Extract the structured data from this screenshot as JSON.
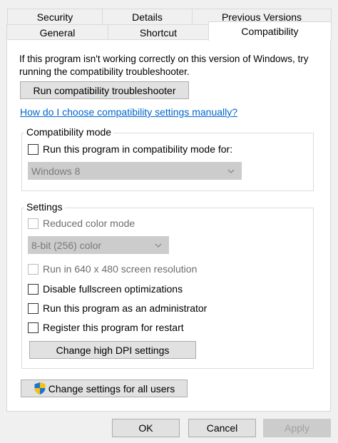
{
  "tabs_row1": [
    "Security",
    "Details",
    "Previous Versions"
  ],
  "tabs_row2": [
    "General",
    "Shortcut",
    "Compatibility"
  ],
  "intro": {
    "line1": "If this program isn't working correctly on this version of Windows, try",
    "line2": "running the compatibility troubleshooter."
  },
  "run_troubleshooter": "Run compatibility troubleshooter",
  "help_link": "How do I choose compatibility settings manually?",
  "compat_mode": {
    "legend": "Compatibility mode",
    "checkbox_label": "Run this program in compatibility mode for:",
    "combo_value": "Windows 8"
  },
  "settings": {
    "legend": "Settings",
    "reduced_color": "Reduced color mode",
    "color_combo_value": "8-bit (256) color",
    "run_640": "Run in 640 x 480 screen resolution",
    "disable_fullscreen": "Disable fullscreen optimizations",
    "run_admin": "Run this program as an administrator",
    "register_restart": "Register this program for restart",
    "dpi_button": "Change high DPI settings"
  },
  "change_all_users": "Change settings for all users",
  "footer": {
    "ok": "OK",
    "cancel": "Cancel",
    "apply": "Apply"
  },
  "colors": {
    "link": "#0066cc",
    "shield_blue": "#1e73d2",
    "shield_yellow": "#f4c20d"
  }
}
